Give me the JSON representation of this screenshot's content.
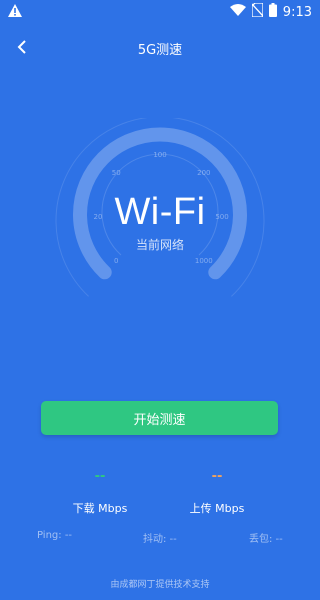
{
  "status_bar": {
    "time": "9:13",
    "alert_icon": "warning-icon",
    "icons": [
      "wifi-icon",
      "no-sim-icon",
      "battery-icon"
    ]
  },
  "header": {
    "title": "5G测速",
    "back_icon": "chevron-left-icon"
  },
  "gauge": {
    "value_text": "Wi-Fi",
    "subtitle": "当前网络",
    "scale_labels": [
      "0",
      "20",
      "50",
      "100",
      "200",
      "500",
      "1000"
    ]
  },
  "actions": {
    "start_label": "开始测速"
  },
  "speeds": {
    "download": {
      "value": "--",
      "label": "下载 Mbps",
      "color": "#2fc782"
    },
    "upload": {
      "value": "--",
      "label": "上传 Mbps",
      "color": "#f0a35e"
    }
  },
  "stats": {
    "ping": "Ping: --",
    "jitter": "抖动: --",
    "loss": "丢包: --"
  },
  "footer": {
    "credit": "由成都网丁提供技术支持"
  },
  "colors": {
    "background": "#2e72e6",
    "accent_green": "#2fc782",
    "upload_orange": "#f0a35e"
  }
}
